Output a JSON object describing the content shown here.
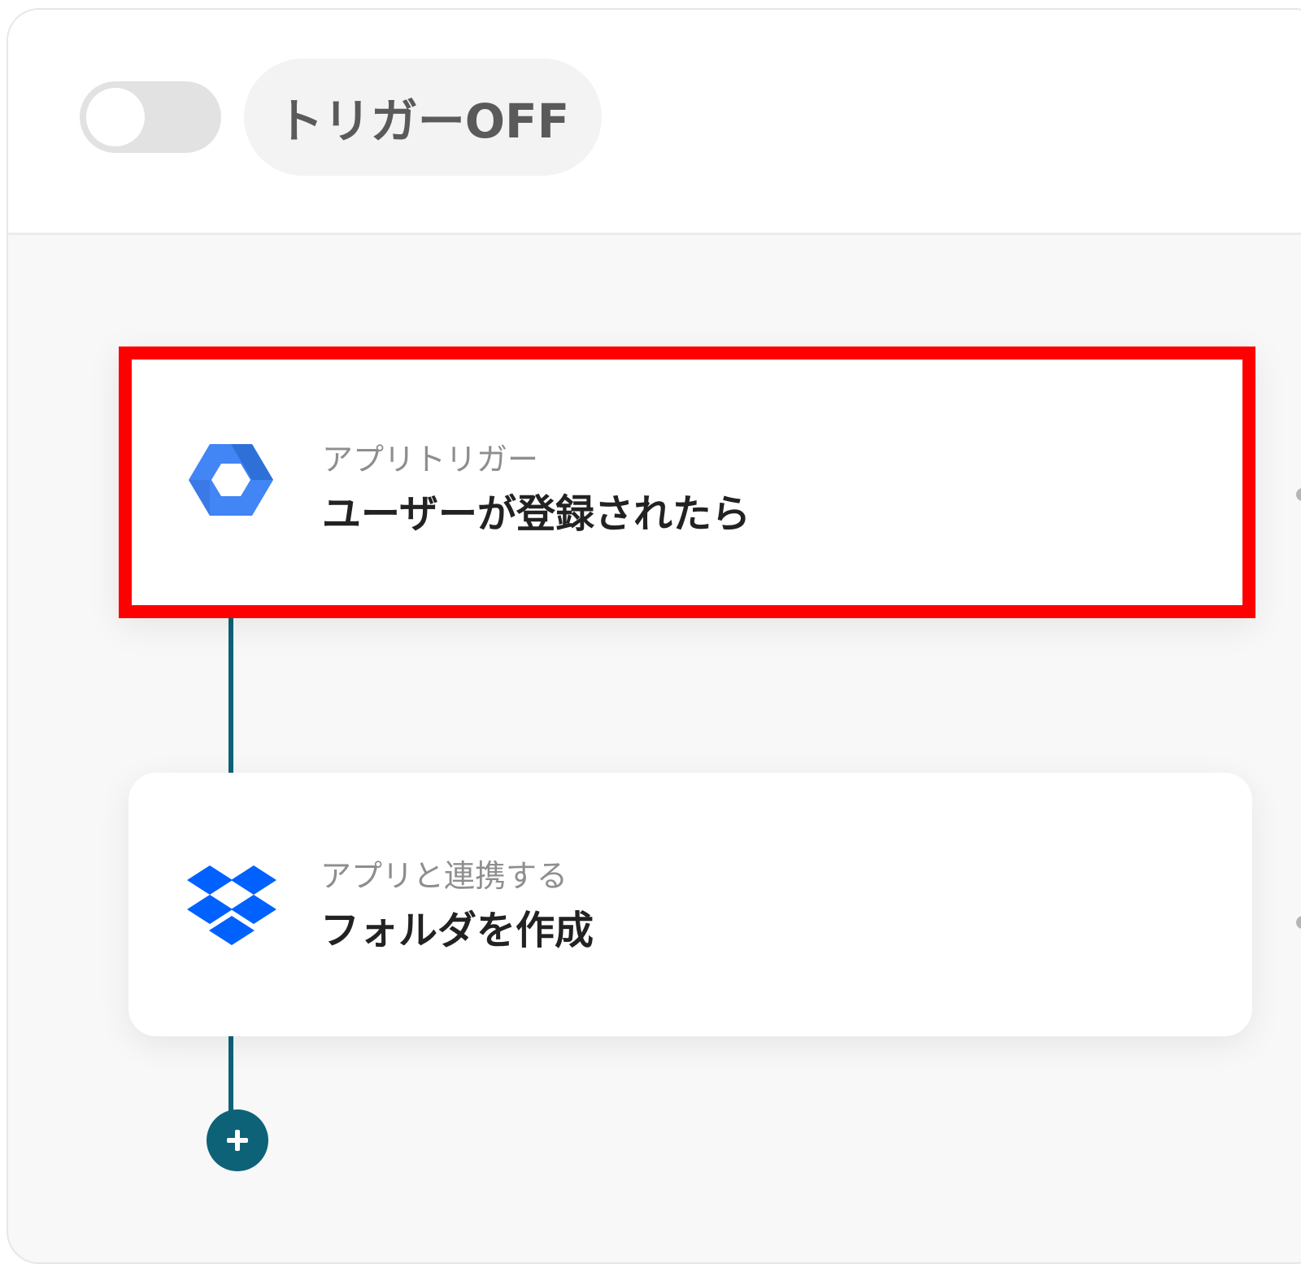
{
  "header": {
    "trigger_toggle": {
      "state": "off"
    },
    "trigger_label": "トリガーOFF"
  },
  "flow": {
    "steps": [
      {
        "app_icon": "google-workspace-hexagon-icon",
        "kind_label": "アプリトリガー",
        "title": "ユーザーが登録されたら",
        "highlighted": true,
        "highlight_color": "#ff0000"
      },
      {
        "app_icon": "dropbox-icon",
        "kind_label": "アプリと連携する",
        "title": "フォルダを作成",
        "highlighted": false
      }
    ],
    "add_step_icon": "plus-icon"
  },
  "colors": {
    "connector": "#0e6278",
    "toggle_off_track": "#e2e2e2",
    "google_blue": "#4285f4",
    "dropbox_blue": "#0061ff",
    "highlight": "#ff0000"
  }
}
